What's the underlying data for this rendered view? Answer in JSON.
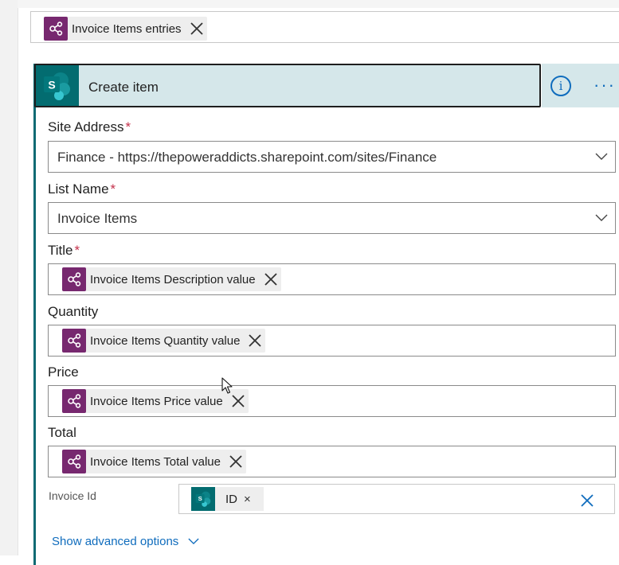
{
  "loop_input": {
    "tag_label": "Invoice Items entries",
    "tag_icon": "data-operation-icon"
  },
  "action": {
    "title": "Create item",
    "connector_icon": "sharepoint-icon",
    "info_icon": "info-icon",
    "more_icon": "more-options-icon",
    "info_glyph": "i",
    "more_glyph": "···"
  },
  "fields": {
    "site_address": {
      "label": "Site Address",
      "required_mark": "*",
      "value": "Finance - https://thepoweraddicts.sharepoint.com/sites/Finance"
    },
    "list_name": {
      "label": "List Name",
      "required_mark": "*",
      "value": "Invoice Items"
    },
    "title": {
      "label": "Title",
      "required_mark": "*",
      "tag": "Invoice Items Description value"
    },
    "quantity": {
      "label": "Quantity",
      "tag": "Invoice Items Quantity value"
    },
    "price": {
      "label": "Price",
      "tag": "Invoice Items Price value"
    },
    "total": {
      "label": "Total",
      "tag": "Invoice Items Total value"
    },
    "invoice_id": {
      "label": "Invoice Id",
      "tag": "ID",
      "remove_glyph": "×"
    }
  },
  "advanced": {
    "label": "Show advanced options"
  },
  "colors": {
    "data_operation": "#77286f",
    "sharepoint": "#036c70",
    "accent": "#0f6cbd",
    "header_bg": "#d5e7ea",
    "required": "#c4314b"
  }
}
